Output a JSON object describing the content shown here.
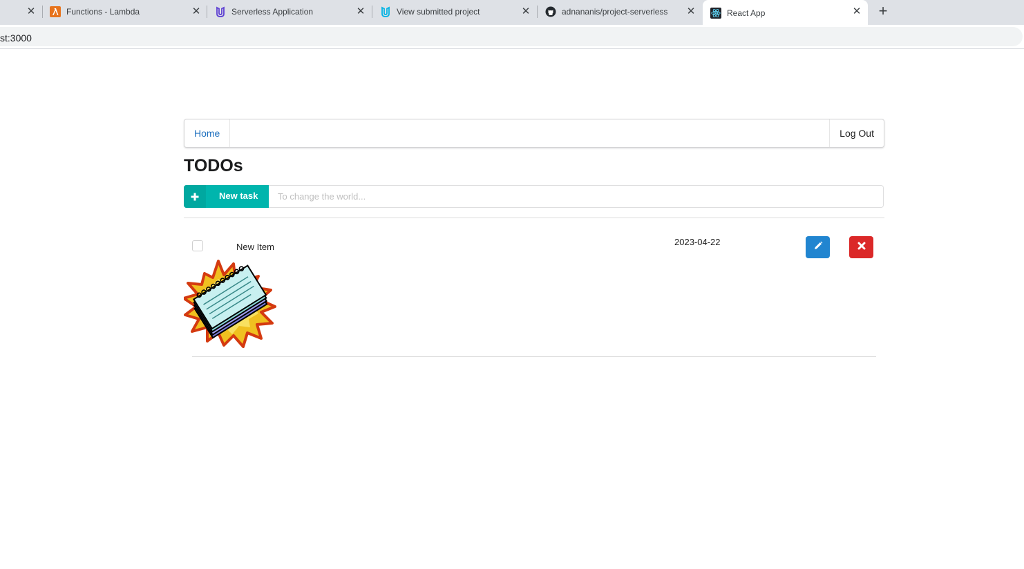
{
  "browser": {
    "tabs": [
      {
        "title": "",
        "icon": "close-icon"
      },
      {
        "title": "Functions - Lambda",
        "icon": "aws-lambda-icon"
      },
      {
        "title": "Serverless Application",
        "icon": "udacity-icon"
      },
      {
        "title": "View submitted project",
        "icon": "udacity-icon"
      },
      {
        "title": "adnananis/project-serverless",
        "icon": "github-icon"
      },
      {
        "title": "React App",
        "icon": "react-icon",
        "active": true
      }
    ],
    "address": "st:3000"
  },
  "menu": {
    "home_label": "Home",
    "logout_label": "Log Out"
  },
  "page": {
    "title": "TODOs"
  },
  "new_task": {
    "button_label": "New task",
    "placeholder": "To change the world...",
    "value": ""
  },
  "todos": [
    {
      "name": "New Item",
      "due_date": "2023-04-22",
      "done": false,
      "attachment": "notepad-clipart-image"
    }
  ],
  "colors": {
    "teal": "#00b5ad",
    "blue": "#2185d0",
    "red": "#db2828",
    "link": "#1e70bf"
  }
}
